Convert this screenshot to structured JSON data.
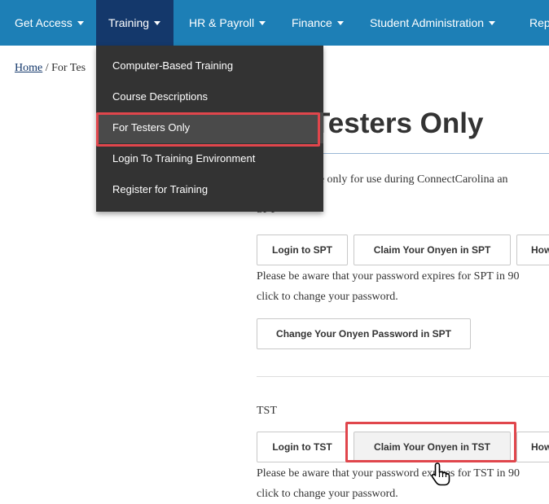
{
  "nav": {
    "items": [
      {
        "label": "Get Access"
      },
      {
        "label": "Training"
      },
      {
        "label": "HR & Payroll"
      },
      {
        "label": "Finance"
      },
      {
        "label": "Student Administration"
      },
      {
        "label": "Rep"
      }
    ]
  },
  "breadcrumb": {
    "home": "Home",
    "separator": " / ",
    "current": "For Tes"
  },
  "dropdown": {
    "items": [
      {
        "label": "Computer-Based Training"
      },
      {
        "label": "Course Descriptions"
      },
      {
        "label": "For Testers Only"
      },
      {
        "label": "Login To Training Environment"
      },
      {
        "label": "Register for Training"
      }
    ]
  },
  "page": {
    "title": "Testers Only",
    "intro": "s are only for use during ConnectCarolina an",
    "spt": {
      "label": "SPT",
      "login_button": "Login to SPT",
      "claim_button": "Claim Your Onyen in SPT",
      "how_button": "How",
      "notice_line1": "Please be aware that your password expires for SPT in 90",
      "notice_line2": "click to change your password.",
      "change_button": "Change Your Onyen Password in SPT"
    },
    "tst": {
      "label": "TST",
      "login_button": "Login to TST",
      "claim_button": "Claim Your Onyen in TST",
      "how_button": "How",
      "notice_line1": "Please be aware that your password expires for TST in 90",
      "notice_line2": "click to change your password."
    }
  },
  "colors": {
    "nav_bg": "#1d7fb6",
    "nav_active": "#14386b",
    "dropdown_bg": "#333333",
    "highlight": "#e0464c"
  },
  "icons": {
    "caret": "caret-down-icon",
    "cursor": "hand-pointer-icon"
  }
}
